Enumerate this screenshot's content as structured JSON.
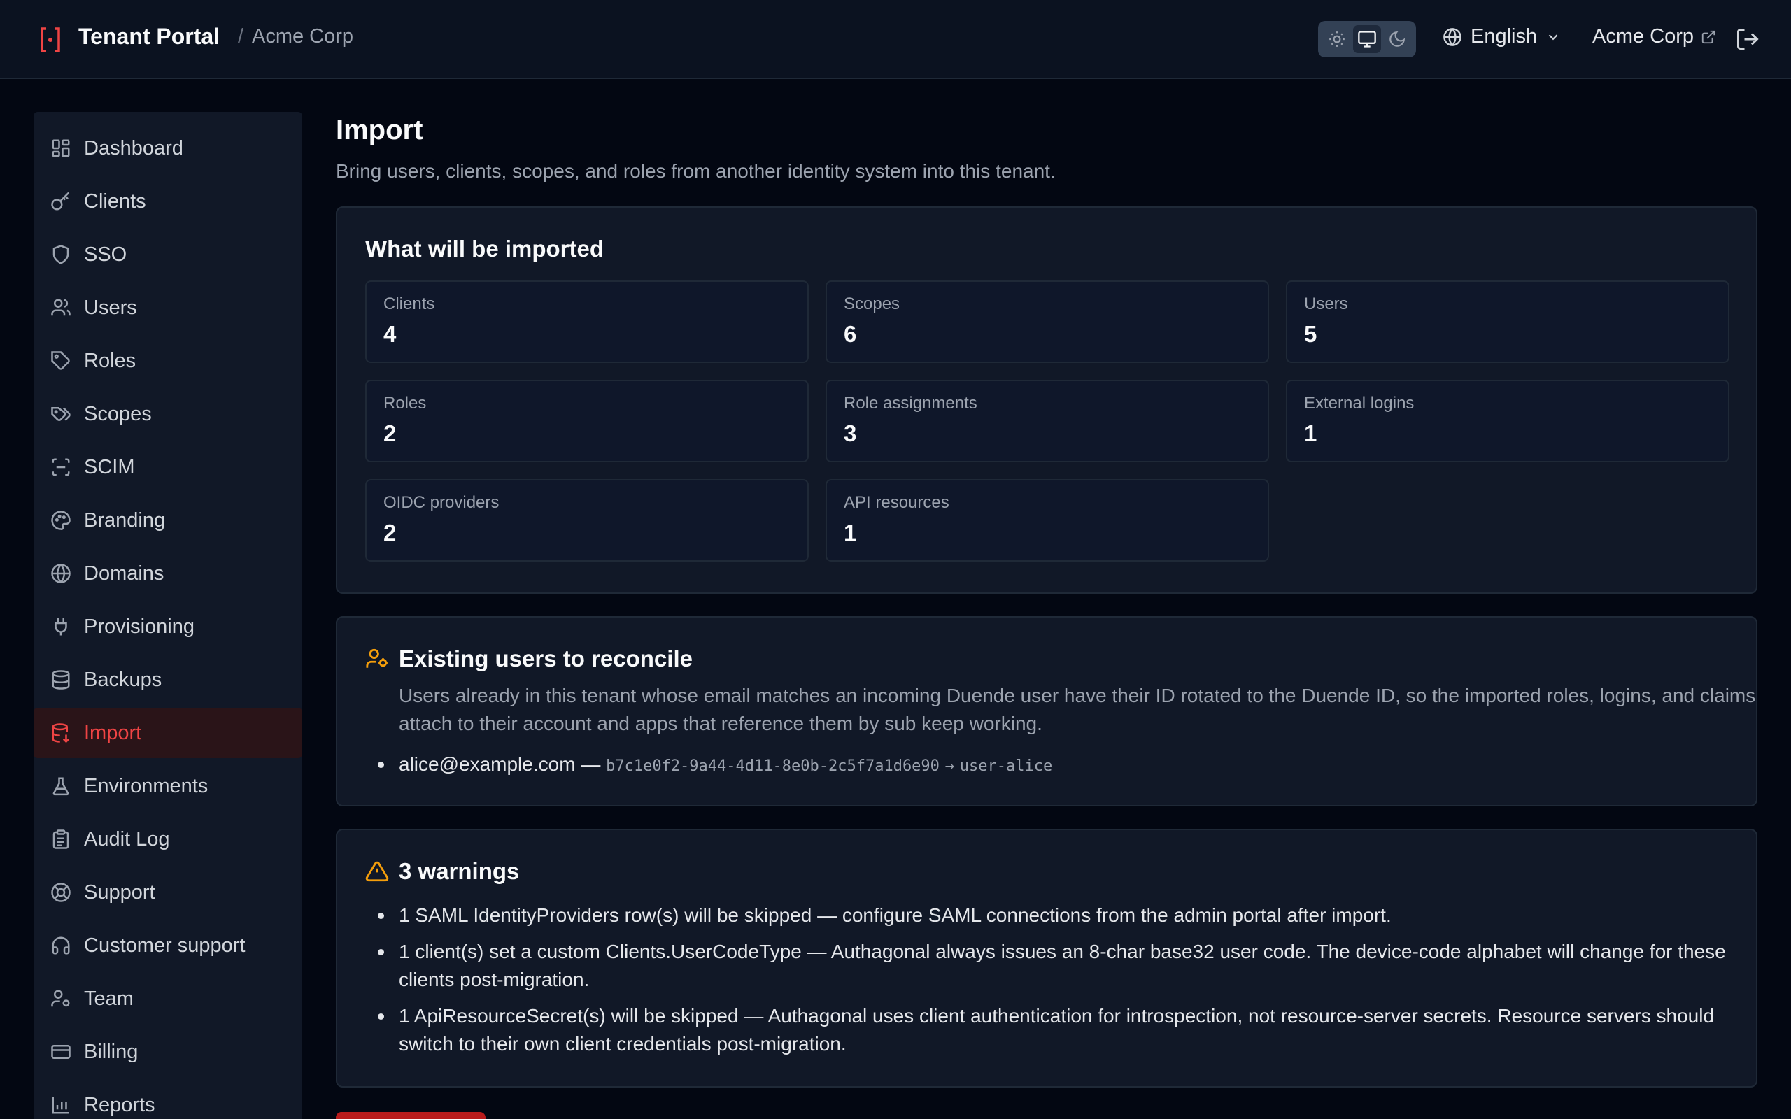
{
  "header": {
    "app_title": "Tenant Portal",
    "separator": "/",
    "tenant": "Acme Corp",
    "theme_options": [
      "light",
      "system",
      "dark"
    ],
    "theme_selected": "system",
    "language": "English",
    "tenant_link": "Acme Corp"
  },
  "sidebar": {
    "items": [
      {
        "label": "Dashboard",
        "icon": "dashboard-icon"
      },
      {
        "label": "Clients",
        "icon": "key-icon"
      },
      {
        "label": "SSO",
        "icon": "shield-icon"
      },
      {
        "label": "Users",
        "icon": "users-icon"
      },
      {
        "label": "Roles",
        "icon": "tag-icon"
      },
      {
        "label": "Scopes",
        "icon": "tags-icon"
      },
      {
        "label": "SCIM",
        "icon": "scan-icon"
      },
      {
        "label": "Branding",
        "icon": "palette-icon"
      },
      {
        "label": "Domains",
        "icon": "globe-icon"
      },
      {
        "label": "Provisioning",
        "icon": "plug-icon"
      },
      {
        "label": "Backups",
        "icon": "database-icon"
      },
      {
        "label": "Import",
        "icon": "database-import-icon"
      },
      {
        "label": "Environments",
        "icon": "flask-icon"
      },
      {
        "label": "Audit Log",
        "icon": "clipboard-icon"
      },
      {
        "label": "Support",
        "icon": "lifebuoy-icon"
      },
      {
        "label": "Customer support",
        "icon": "headset-icon"
      },
      {
        "label": "Team",
        "icon": "user-cog-icon"
      },
      {
        "label": "Billing",
        "icon": "credit-card-icon"
      },
      {
        "label": "Reports",
        "icon": "bar-chart-icon"
      }
    ],
    "active": "Import"
  },
  "page": {
    "title": "Import",
    "subtitle": "Bring users, clients, scopes, and roles from another identity system into this tenant."
  },
  "summary": {
    "title": "What will be imported",
    "stats": [
      {
        "label": "Clients",
        "value": "4"
      },
      {
        "label": "Scopes",
        "value": "6"
      },
      {
        "label": "Users",
        "value": "5"
      },
      {
        "label": "Roles",
        "value": "2"
      },
      {
        "label": "Role assignments",
        "value": "3"
      },
      {
        "label": "External logins",
        "value": "1"
      },
      {
        "label": "OIDC providers",
        "value": "2"
      },
      {
        "label": "API resources",
        "value": "1"
      }
    ]
  },
  "reconcile": {
    "title": "Existing users to reconcile",
    "description": "Users already in this tenant whose email matches an incoming Duende user have their ID rotated to the Duende ID, so the imported roles, logins, and claims attach to their account and apps that reference them by sub keep working.",
    "entries": [
      {
        "email": "alice@example.com",
        "dash": "—",
        "from_id": "b7c1e0f2-9a44-4d11-8e0b-2c5f7a1d6e90",
        "arrow": "→",
        "to_id": "user-alice"
      }
    ]
  },
  "warnings": {
    "title": "3 warnings",
    "items": [
      "1 SAML IdentityProviders row(s) will be skipped — configure SAML connections from the admin portal after import.",
      "1 client(s) set a custom Clients.UserCodeType — Authagonal always issues an 8-char base32 user code. The device-code alphabet will change for these clients post-migration.",
      "1 ApiResourceSecret(s) will be skipped — Authagonal uses client authentication for introspection, not resource-server secrets. Resource servers should switch to their own client credentials post-migration."
    ]
  },
  "colors": {
    "accent": "#ef4444",
    "warning": "#f59e0b",
    "background": "#030712",
    "surface": "#111827"
  }
}
